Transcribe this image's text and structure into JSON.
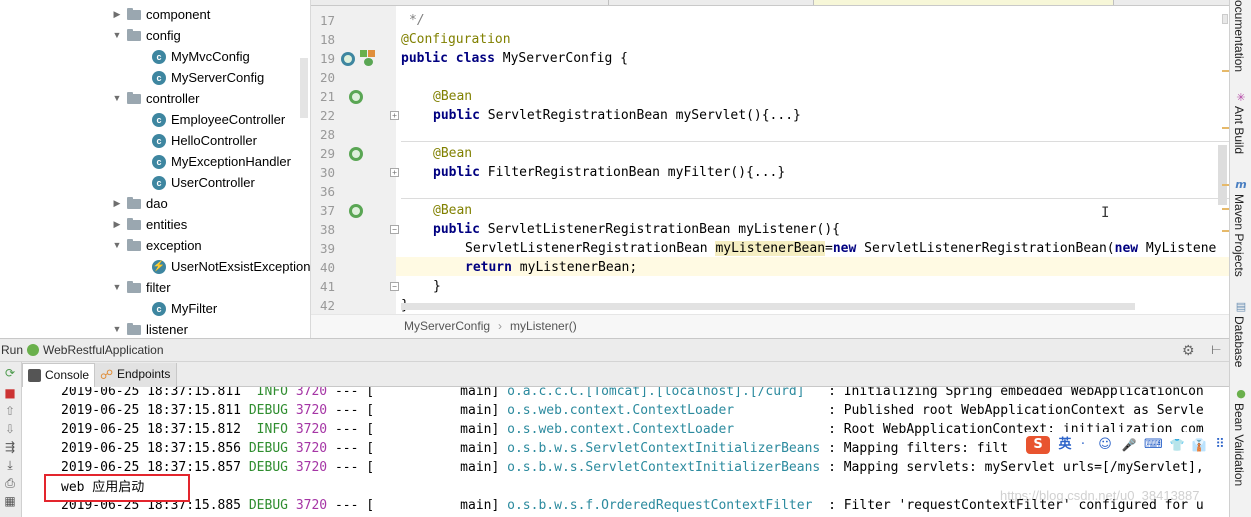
{
  "project_tree": {
    "items": [
      {
        "label": "component",
        "type": "folder",
        "state": "collapsed"
      },
      {
        "label": "config",
        "type": "folder",
        "state": "expanded"
      },
      {
        "label": "MyMvcConfig",
        "type": "class"
      },
      {
        "label": "MyServerConfig",
        "type": "class"
      },
      {
        "label": "controller",
        "type": "folder",
        "state": "expanded"
      },
      {
        "label": "EmployeeController",
        "type": "class"
      },
      {
        "label": "HelloController",
        "type": "class"
      },
      {
        "label": "MyExceptionHandler",
        "type": "class"
      },
      {
        "label": "UserController",
        "type": "class"
      },
      {
        "label": "dao",
        "type": "folder",
        "state": "collapsed"
      },
      {
        "label": "entities",
        "type": "folder",
        "state": "collapsed"
      },
      {
        "label": "exception",
        "type": "folder",
        "state": "expanded"
      },
      {
        "label": "UserNotExsistException",
        "type": "exception"
      },
      {
        "label": "filter",
        "type": "folder",
        "state": "expanded"
      },
      {
        "label": "MyFilter",
        "type": "class"
      },
      {
        "label": "listener",
        "type": "folder",
        "state": "expanded"
      }
    ]
  },
  "editor": {
    "line_numbers": [
      "17",
      "18",
      "19",
      "20",
      "21",
      "22",
      "28",
      "29",
      "30",
      "36",
      "37",
      "38",
      "39",
      "40",
      "41",
      "42"
    ],
    "code": {
      "l17": "*/",
      "l18": "@Configuration",
      "l19_kw": "public class",
      "l19_rest": " MyServerConfig {",
      "l21": "@Bean",
      "l22_kw": "public",
      "l22_rest": " ServletRegistrationBean myServlet(){...}",
      "l29": "@Bean",
      "l30_kw": "public",
      "l30_rest": " FilterRegistrationBean myFilter(){...}",
      "l37": "@Bean",
      "l38_kw": "public",
      "l38_rest": " ServletListenerRegistrationBean myListener(){",
      "l39_a": "ServletListenerRegistrationBean ",
      "l39_b": "myListenerBean",
      "l39_c": "=",
      "l39_kw": "new",
      "l39_d": " ServletListenerRegistrationBean(",
      "l39_kw2": "new",
      "l39_e": " MyListene",
      "l40_kw": "return",
      "l40_rest": " myListenerBean;",
      "l41": "}",
      "l42": "}"
    },
    "breadcrumb": [
      "MyServerConfig",
      "myListener()"
    ]
  },
  "right_tool_strip": {
    "tabs": [
      "ocumentation",
      "Ant Build",
      "Maven Projects",
      "Database",
      "Bean Validation"
    ]
  },
  "run_panel": {
    "label": "Run",
    "app_name": "WebRestfulApplication",
    "tabs": [
      "Console",
      "Endpoints"
    ],
    "log_lines": [
      {
        "ts": "2019-06-25 18:37:15.811",
        "level": " INFO",
        "pid": "3720",
        "sep": " --- [",
        "thread": "           main]",
        "logger": " o.a.c.c.C.[Tomcat].[localhost].[/curd]",
        "pad": "   ",
        "msg": ": Initializing Spring embedded WebApplicationCon"
      },
      {
        "ts": "2019-06-25 18:37:15.811",
        "level": "DEBUG",
        "pid": "3720",
        "sep": " --- [",
        "thread": "           main]",
        "logger": " o.s.web.context.ContextLoader",
        "pad": "            ",
        "msg": ": Published root WebApplicationContext as Servle"
      },
      {
        "ts": "2019-06-25 18:37:15.812",
        "level": " INFO",
        "pid": "3720",
        "sep": " --- [",
        "thread": "           main]",
        "logger": " o.s.web.context.ContextLoader",
        "pad": "            ",
        "msg": ": Root WebApplicationContext: initialization com"
      },
      {
        "ts": "2019-06-25 18:37:15.856",
        "level": "DEBUG",
        "pid": "3720",
        "sep": " --- [",
        "thread": "           main]",
        "logger": " o.s.b.w.s.ServletContextInitializerBeans",
        "pad": " ",
        "msg": ": Mapping filters: filt"
      },
      {
        "ts": "2019-06-25 18:37:15.857",
        "level": "DEBUG",
        "pid": "3720",
        "sep": " --- [",
        "thread": "           main]",
        "logger": " o.s.b.w.s.ServletContextInitializerBeans",
        "pad": " ",
        "msg": ": Mapping servlets: myServlet urls=[/myServlet],"
      },
      {
        "ts": "2019-06-25 18:37:15.885",
        "level": "DEBUG",
        "pid": "3720",
        "sep": " --- [",
        "thread": "           main]",
        "logger": " o.s.b.w.s.f.OrderedRequestContextFilter",
        "pad": "  ",
        "msg": ": Filter 'requestContextFilter' configured for u"
      }
    ],
    "highlight_text": "web 应用启动"
  },
  "ime_toolbar": {
    "items": [
      "S",
      "英",
      "·",
      "☺",
      "🎤",
      "⌨",
      "👕",
      "👔",
      "⠿"
    ]
  },
  "watermark": "https://blog.csdn.net/u0_38413887",
  "colors": {
    "keyword": "#000080",
    "annotation": "#808000",
    "debug": "#2f8d2f",
    "pid": "#a535a5",
    "logger": "#2b8a9e",
    "highlight_box": "#e3252d"
  }
}
